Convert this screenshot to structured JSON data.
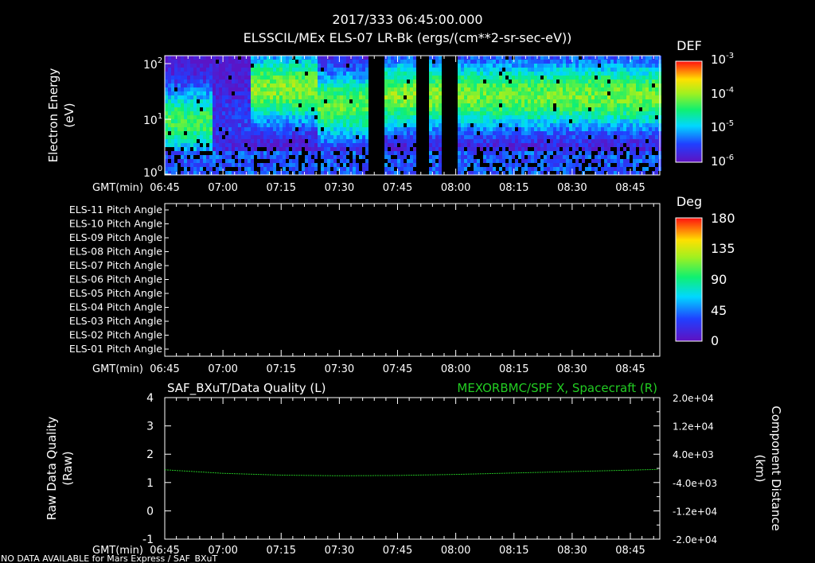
{
  "header": {
    "timestamp": "2017/333 06:45:00.000",
    "subtitle": "ELSSCIL/MEx ELS-07 LR-Bk  (ergs/(cm**2-sr-sec-eV))"
  },
  "time_axis": {
    "label": "GMT(min)",
    "ticks": [
      "06:45",
      "07:00",
      "07:15",
      "07:30",
      "07:45",
      "08:00",
      "08:15",
      "08:30",
      "08:45"
    ]
  },
  "colors": {
    "background": "#000000",
    "axes": "#ffffff",
    "trace_green": "#22c022",
    "title_green": "#22cc22"
  },
  "panels": {
    "spectrogram": {
      "ylabel_line1": "Electron Energy",
      "ylabel_line2": "(eV)",
      "yticks": [
        {
          "base": "10",
          "exp": "2"
        },
        {
          "base": "10",
          "exp": "1"
        },
        {
          "base": "10",
          "exp": "0"
        }
      ],
      "colorbar": {
        "title": "DEF",
        "ticks": [
          {
            "base": "10",
            "exp": "-3"
          },
          {
            "base": "10",
            "exp": "-4"
          },
          {
            "base": "10",
            "exp": "-5"
          },
          {
            "base": "10",
            "exp": "-6"
          }
        ]
      }
    },
    "pitch": {
      "rows": [
        "ELS-11 Pitch Angle",
        "ELS-10 Pitch Angle",
        "ELS-09 Pitch Angle",
        "ELS-08 Pitch Angle",
        "ELS-07 Pitch Angle",
        "ELS-06 Pitch Angle",
        "ELS-05 Pitch Angle",
        "ELS-04 Pitch Angle",
        "ELS-03 Pitch Angle",
        "ELS-02 Pitch Angle",
        "ELS-01 Pitch Angle"
      ],
      "colorbar": {
        "title": "Deg",
        "ticks": [
          "180",
          "135",
          "90",
          "45",
          "0"
        ]
      }
    },
    "line": {
      "title_left": "SAF_BXuT/Data Quality (L)",
      "title_right": "MEXORBMC/SPF X, Spacecraft (R)",
      "ylabel_left_line1": "Raw Data Quality",
      "ylabel_left_line2": "(Raw)",
      "ylabel_right_line1": "Component Distance",
      "ylabel_right_line2": "(km)",
      "yticks_left": [
        "4",
        "3",
        "2",
        "1",
        "0",
        "-1"
      ],
      "yticks_right": [
        "2.0e+04",
        "1.2e+04",
        "4.0e+03",
        "-4.0e+03",
        "-1.2e+04",
        "-2.0e+04"
      ]
    }
  },
  "footer": {
    "message": "NO DATA AVAILABLE for Mars Express / SAF_BXuT"
  },
  "chart_data": [
    {
      "type": "heatmap",
      "ylabel": "Electron Energy (eV)",
      "yscale": "log",
      "ylim": [
        1,
        150
      ],
      "x_range": [
        "06:45",
        "08:52"
      ],
      "colorbar_label": "DEF",
      "colorbar_range": [
        1e-06,
        0.001
      ],
      "data_gaps": [
        [
          "07:38",
          "07:41"
        ],
        [
          "07:50",
          "07:53"
        ],
        [
          "07:57",
          "08:00"
        ]
      ],
      "energy_profile": [
        {
          "from": "06:45",
          "to": "06:57",
          "center_eV": 10,
          "level": 0.55
        },
        {
          "from": "06:57",
          "to": "07:07",
          "center_eV": 10,
          "level": 0.15
        },
        {
          "from": "07:07",
          "to": "07:24",
          "center_eV": 40,
          "level": 0.65
        },
        {
          "from": "07:24",
          "to": "07:38",
          "center_eV": 20,
          "level": 0.6
        },
        {
          "from": "07:41",
          "to": "07:57",
          "center_eV": 30,
          "level": 0.65
        },
        {
          "from": "08:00",
          "to": "08:52",
          "center_eV": 30,
          "level": 0.62
        }
      ]
    },
    {
      "type": "heatmap",
      "rows": [
        "ELS-11",
        "ELS-10",
        "ELS-09",
        "ELS-08",
        "ELS-07",
        "ELS-06",
        "ELS-05",
        "ELS-04",
        "ELS-03",
        "ELS-02",
        "ELS-01"
      ],
      "colorbar_label": "Deg",
      "colorbar_range": [
        0,
        180
      ],
      "values": []
    },
    {
      "type": "line",
      "title": "MEXORBMC/SPF X, Spacecraft (R)",
      "ylabel": "Component Distance (km)",
      "ylim": [
        -20000,
        20000
      ],
      "series": [
        {
          "name": "MEXORBMC/SPF X, Spacecraft (R)",
          "x": [
            "06:45",
            "07:00",
            "07:15",
            "07:30",
            "07:45",
            "08:00",
            "08:15",
            "08:30",
            "08:45",
            "08:52"
          ],
          "values": [
            -400,
            -1400,
            -1900,
            -2100,
            -2000,
            -1700,
            -1300,
            -900,
            -500,
            -300
          ]
        }
      ],
      "y2label": "Raw Data Quality (Raw)",
      "y2lim": [
        -1,
        4
      ],
      "y2series": []
    }
  ]
}
